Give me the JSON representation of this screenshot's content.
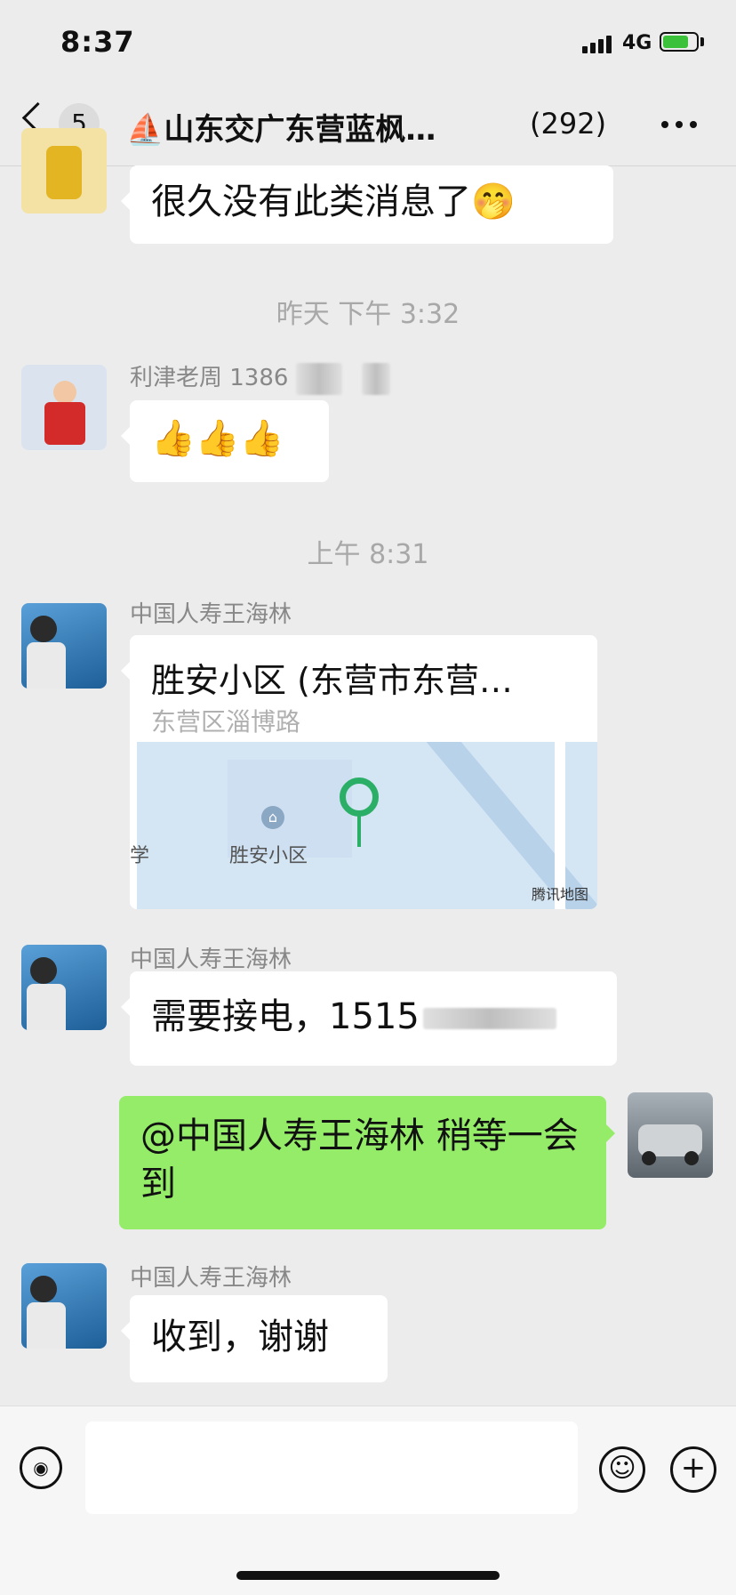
{
  "status": {
    "time": "8:37",
    "network": "4G"
  },
  "nav": {
    "unread": "5",
    "title_icon": "sailboat-emoji",
    "title": "⛵山东交广东营蓝枫…",
    "member_count": "(292)"
  },
  "messages": {
    "m0": {
      "text": "很久没有此类消息了🤭"
    },
    "ts1": "昨天 下午 3:32",
    "m1": {
      "sender": "利津老周 1386",
      "text": "👍👍👍"
    },
    "ts2": "上午 8:31",
    "m2": {
      "sender": "中国人寿王海林",
      "location_title": "胜安小区 (东营市东营…",
      "location_address": "东营区淄博路",
      "map_poi": "胜安小区",
      "map_left_label": "学",
      "map_brand": "腾讯地图"
    },
    "m3": {
      "sender": "中国人寿王海林",
      "text": "需要接电，1515"
    },
    "m4": {
      "text": "@中国人寿王海林 稍等一会到"
    },
    "m5": {
      "sender": "中国人寿王海林",
      "text": "收到，谢谢"
    }
  },
  "input": {
    "voice_icon": "voice-icon",
    "emoji_icon": "emoji-icon",
    "plus_icon": "plus-icon"
  },
  "colors": {
    "background": "#ececec",
    "my_bubble": "#95ec69",
    "map_pin": "#2bae66"
  }
}
